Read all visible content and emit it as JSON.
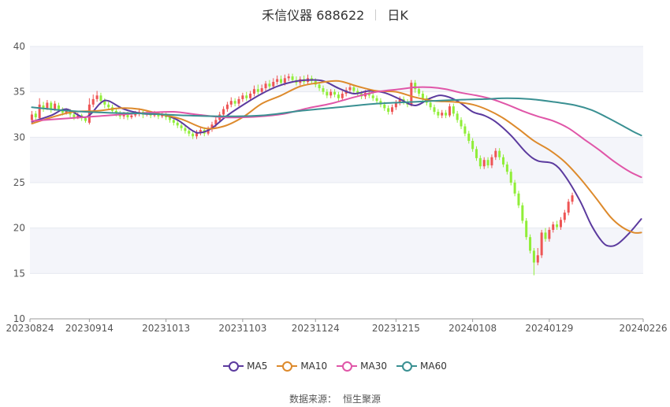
{
  "header": {
    "stock": "禾信仪器 688622",
    "period": "日K"
  },
  "source": {
    "label": "数据来源：",
    "provider": "恒生聚源"
  },
  "colors": {
    "up": "#ee5555",
    "down": "#90ee38",
    "grid": "#e6e9f0",
    "band": "#f4f5fa"
  },
  "chart_data": {
    "type": "line",
    "title": "禾信仪器 688622 日K",
    "y_ticks": [
      10,
      15,
      20,
      25,
      30,
      35,
      40
    ],
    "ylim": [
      10,
      40
    ],
    "x_ticks": [
      "20230824",
      "20230914",
      "20231013",
      "20231103",
      "20231124",
      "20231215",
      "20240108",
      "20240129",
      "20240226"
    ],
    "x_tick_index": [
      0,
      15,
      35,
      55,
      74,
      95,
      115,
      135,
      159
    ],
    "n_days": 160,
    "candles_note": "daily candlesticks, index 0..159, values [open, close, low, high]",
    "candles": [
      [
        31.9,
        32.5,
        31.6,
        32.9
      ],
      [
        32.6,
        32.2,
        31.8,
        32.9
      ],
      [
        32.1,
        33.6,
        31.9,
        34.3
      ],
      [
        33.5,
        33.2,
        32.8,
        33.9
      ],
      [
        33.2,
        33.8,
        33.0,
        34.1
      ],
      [
        33.8,
        33.1,
        32.7,
        34.0
      ],
      [
        33.1,
        33.7,
        32.9,
        34.0
      ],
      [
        33.5,
        33.1,
        32.8,
        33.8
      ],
      [
        33.1,
        32.7,
        32.4,
        33.3
      ],
      [
        32.7,
        32.9,
        32.5,
        33.2
      ],
      [
        32.9,
        32.5,
        32.2,
        33.1
      ],
      [
        32.5,
        32.2,
        31.9,
        32.7
      ],
      [
        32.2,
        32.4,
        32.0,
        32.7
      ],
      [
        32.4,
        32.1,
        31.8,
        32.6
      ],
      [
        32.1,
        31.8,
        31.6,
        32.3
      ],
      [
        31.6,
        33.6,
        31.4,
        34.3
      ],
      [
        33.6,
        34.2,
        33.3,
        34.7
      ],
      [
        34.2,
        34.6,
        33.9,
        35.1
      ],
      [
        34.6,
        34.0,
        33.6,
        34.9
      ],
      [
        34.0,
        33.6,
        33.2,
        34.3
      ],
      [
        33.6,
        33.3,
        33.0,
        33.9
      ],
      [
        33.3,
        32.9,
        32.6,
        33.6
      ],
      [
        32.9,
        32.6,
        32.3,
        33.2
      ],
      [
        32.6,
        32.3,
        32.0,
        32.9
      ],
      [
        32.3,
        32.5,
        32.0,
        32.8
      ],
      [
        32.5,
        32.2,
        31.9,
        32.8
      ],
      [
        32.2,
        32.4,
        32.0,
        32.7
      ],
      [
        32.4,
        32.6,
        32.2,
        32.9
      ],
      [
        32.6,
        32.8,
        32.3,
        33.2
      ],
      [
        32.8,
        32.5,
        32.1,
        33.1
      ],
      [
        32.5,
        32.7,
        32.3,
        33.0
      ],
      [
        32.7,
        32.4,
        32.1,
        32.9
      ],
      [
        32.4,
        32.6,
        32.2,
        32.9
      ],
      [
        32.6,
        32.3,
        32.0,
        32.8
      ],
      [
        32.3,
        32.5,
        32.1,
        32.8
      ],
      [
        32.5,
        32.2,
        31.9,
        32.7
      ],
      [
        32.2,
        31.9,
        31.6,
        32.5
      ],
      [
        31.9,
        31.6,
        31.3,
        32.2
      ],
      [
        31.6,
        31.3,
        31.0,
        31.9
      ],
      [
        31.3,
        31.0,
        30.7,
        31.6
      ],
      [
        31.0,
        30.7,
        30.4,
        31.3
      ],
      [
        30.7,
        30.4,
        30.1,
        31.0
      ],
      [
        30.4,
        30.1,
        29.8,
        30.7
      ],
      [
        30.1,
        30.5,
        29.8,
        30.8
      ],
      [
        30.5,
        30.8,
        30.2,
        31.1
      ],
      [
        30.8,
        30.4,
        30.1,
        31.1
      ],
      [
        30.4,
        30.9,
        30.2,
        31.2
      ],
      [
        30.9,
        31.4,
        30.6,
        31.7
      ],
      [
        31.4,
        31.9,
        31.1,
        32.2
      ],
      [
        31.9,
        32.5,
        31.6,
        32.8
      ],
      [
        32.5,
        33.1,
        32.2,
        33.4
      ],
      [
        33.1,
        33.6,
        32.8,
        33.9
      ],
      [
        33.6,
        34.0,
        33.3,
        34.4
      ],
      [
        34.0,
        33.7,
        33.4,
        34.3
      ],
      [
        33.7,
        34.2,
        33.4,
        34.5
      ],
      [
        34.2,
        34.6,
        33.9,
        34.9
      ],
      [
        34.6,
        34.3,
        34.0,
        35.0
      ],
      [
        34.3,
        34.8,
        34.0,
        35.1
      ],
      [
        34.8,
        35.3,
        34.5,
        35.7
      ],
      [
        35.3,
        35.0,
        34.7,
        35.8
      ],
      [
        35.0,
        35.4,
        34.7,
        35.8
      ],
      [
        35.4,
        35.9,
        35.1,
        36.2
      ],
      [
        35.9,
        35.6,
        35.3,
        36.3
      ],
      [
        35.6,
        36.1,
        35.3,
        36.5
      ],
      [
        36.1,
        36.4,
        35.8,
        36.8
      ],
      [
        36.4,
        36.0,
        35.7,
        36.8
      ],
      [
        36.0,
        36.5,
        35.7,
        36.9
      ],
      [
        36.5,
        36.7,
        36.2,
        37.0
      ],
      [
        36.7,
        36.3,
        36.0,
        37.0
      ],
      [
        36.3,
        36.0,
        35.7,
        36.7
      ],
      [
        36.0,
        36.4,
        35.7,
        36.7
      ],
      [
        36.4,
        36.1,
        35.8,
        36.8
      ],
      [
        36.1,
        36.5,
        35.8,
        36.9
      ],
      [
        36.5,
        36.2,
        35.9,
        36.8
      ],
      [
        36.2,
        35.8,
        35.5,
        36.5
      ],
      [
        35.8,
        35.4,
        35.1,
        36.1
      ],
      [
        35.4,
        35.0,
        34.7,
        35.7
      ],
      [
        35.0,
        34.6,
        34.3,
        35.3
      ],
      [
        34.6,
        35.0,
        34.3,
        35.3
      ],
      [
        35.0,
        34.7,
        34.4,
        35.3
      ],
      [
        34.7,
        34.3,
        34.0,
        35.0
      ],
      [
        34.3,
        34.8,
        34.0,
        35.1
      ],
      [
        34.8,
        35.2,
        34.5,
        35.5
      ],
      [
        35.2,
        35.5,
        34.9,
        35.8
      ],
      [
        35.5,
        35.1,
        34.8,
        35.8
      ],
      [
        35.1,
        34.8,
        34.5,
        35.4
      ],
      [
        34.8,
        34.5,
        34.2,
        35.1
      ],
      [
        34.5,
        34.9,
        34.2,
        35.2
      ],
      [
        34.9,
        34.6,
        34.3,
        35.2
      ],
      [
        34.6,
        34.3,
        34.0,
        34.9
      ],
      [
        34.3,
        34.0,
        33.7,
        34.6
      ],
      [
        34.0,
        33.6,
        33.3,
        34.3
      ],
      [
        33.6,
        33.2,
        32.9,
        33.9
      ],
      [
        33.2,
        32.8,
        32.5,
        33.5
      ],
      [
        32.8,
        33.3,
        32.5,
        33.6
      ],
      [
        33.3,
        33.8,
        33.0,
        34.1
      ],
      [
        33.8,
        34.2,
        33.5,
        34.5
      ],
      [
        34.2,
        33.9,
        33.6,
        34.5
      ],
      [
        33.9,
        33.6,
        33.3,
        34.2
      ],
      [
        33.6,
        36.0,
        33.4,
        36.3
      ],
      [
        36.0,
        35.3,
        34.9,
        36.3
      ],
      [
        35.3,
        34.8,
        34.5,
        35.6
      ],
      [
        34.8,
        34.3,
        34.0,
        35.1
      ],
      [
        34.3,
        33.8,
        33.5,
        34.6
      ],
      [
        33.8,
        33.3,
        33.0,
        34.1
      ],
      [
        33.3,
        32.8,
        32.5,
        33.6
      ],
      [
        32.8,
        32.4,
        32.1,
        33.1
      ],
      [
        32.4,
        32.7,
        32.1,
        33.0
      ],
      [
        32.7,
        32.4,
        32.1,
        33.0
      ],
      [
        32.4,
        33.4,
        32.2,
        33.7
      ],
      [
        33.4,
        32.6,
        32.3,
        33.7
      ],
      [
        32.6,
        31.9,
        31.6,
        32.9
      ],
      [
        31.9,
        31.2,
        30.9,
        32.2
      ],
      [
        31.2,
        30.4,
        30.1,
        31.5
      ],
      [
        30.4,
        29.6,
        29.3,
        30.7
      ],
      [
        29.6,
        28.7,
        28.4,
        29.9
      ],
      [
        28.7,
        27.7,
        27.4,
        29.0
      ],
      [
        27.7,
        26.8,
        26.5,
        28.0
      ],
      [
        26.8,
        27.5,
        26.5,
        27.8
      ],
      [
        27.5,
        26.9,
        26.6,
        27.8
      ],
      [
        26.9,
        27.8,
        26.6,
        28.1
      ],
      [
        27.8,
        28.5,
        27.5,
        28.8
      ],
      [
        28.5,
        27.8,
        27.5,
        28.8
      ],
      [
        27.8,
        27.0,
        26.7,
        28.1
      ],
      [
        27.0,
        26.2,
        25.9,
        27.3
      ],
      [
        26.2,
        25.0,
        24.7,
        26.5
      ],
      [
        25.0,
        23.8,
        23.5,
        25.3
      ],
      [
        23.8,
        22.5,
        22.2,
        24.1
      ],
      [
        22.5,
        20.8,
        20.5,
        22.8
      ],
      [
        20.8,
        19.0,
        18.7,
        21.1
      ],
      [
        19.0,
        17.5,
        17.2,
        19.3
      ],
      [
        17.5,
        16.2,
        14.8,
        17.8
      ],
      [
        16.2,
        17.0,
        15.9,
        17.8
      ],
      [
        17.0,
        19.5,
        16.7,
        19.8
      ],
      [
        19.5,
        18.8,
        18.5,
        20.0
      ],
      [
        18.8,
        19.8,
        18.5,
        20.1
      ],
      [
        19.8,
        20.4,
        19.5,
        20.7
      ],
      [
        20.4,
        20.1,
        19.8,
        20.8
      ],
      [
        20.1,
        20.9,
        19.8,
        21.2
      ],
      [
        20.9,
        21.7,
        20.6,
        22.0
      ],
      [
        21.7,
        22.9,
        21.4,
        23.2
      ],
      [
        22.9,
        23.6,
        22.6,
        23.9
      ]
    ],
    "series": [
      {
        "name": "MA5",
        "color": "#5b3a9e",
        "values": [
          [
            0,
            31.7
          ],
          [
            5,
            32.4
          ],
          [
            9,
            33.1
          ],
          [
            14,
            32.2
          ],
          [
            18,
            33.8
          ],
          [
            20,
            34.0
          ],
          [
            24,
            33.1
          ],
          [
            29,
            32.6
          ],
          [
            34,
            32.5
          ],
          [
            38,
            31.9
          ],
          [
            42,
            30.7
          ],
          [
            44,
            30.5
          ],
          [
            47,
            31.0
          ],
          [
            51,
            32.4
          ],
          [
            56,
            33.8
          ],
          [
            60,
            34.8
          ],
          [
            64,
            35.6
          ],
          [
            68,
            36.1
          ],
          [
            72,
            36.3
          ],
          [
            76,
            36.2
          ],
          [
            80,
            35.4
          ],
          [
            84,
            34.8
          ],
          [
            88,
            35.1
          ],
          [
            92,
            34.9
          ],
          [
            96,
            34.2
          ],
          [
            100,
            33.5
          ],
          [
            104,
            34.3
          ],
          [
            107,
            34.6
          ],
          [
            111,
            34.0
          ],
          [
            115,
            32.8
          ],
          [
            118,
            32.4
          ],
          [
            121,
            31.7
          ],
          [
            125,
            30.2
          ],
          [
            129,
            28.3
          ],
          [
            132,
            27.4
          ],
          [
            136,
            27.1
          ],
          [
            139,
            25.8
          ],
          [
            143,
            23.0
          ],
          [
            146,
            20.3
          ],
          [
            149,
            18.4
          ],
          [
            151,
            18.0
          ],
          [
            153,
            18.3
          ],
          [
            156,
            19.5
          ],
          [
            159,
            21.0
          ]
        ]
      },
      {
        "name": "MA10",
        "color": "#dd8a2c",
        "values": [
          [
            0,
            31.5
          ],
          [
            6,
            32.3
          ],
          [
            11,
            32.8
          ],
          [
            17,
            32.9
          ],
          [
            23,
            33.2
          ],
          [
            28,
            33.1
          ],
          [
            33,
            32.6
          ],
          [
            39,
            32.0
          ],
          [
            45,
            31.0
          ],
          [
            50,
            31.2
          ],
          [
            55,
            32.2
          ],
          [
            60,
            33.7
          ],
          [
            65,
            34.6
          ],
          [
            70,
            35.6
          ],
          [
            75,
            36.0
          ],
          [
            80,
            36.2
          ],
          [
            85,
            35.6
          ],
          [
            90,
            35.1
          ],
          [
            95,
            35.0
          ],
          [
            100,
            34.4
          ],
          [
            105,
            34.0
          ],
          [
            110,
            33.9
          ],
          [
            115,
            33.6
          ],
          [
            119,
            33.0
          ],
          [
            123,
            32.1
          ],
          [
            127,
            30.9
          ],
          [
            131,
            29.6
          ],
          [
            135,
            28.6
          ],
          [
            139,
            27.3
          ],
          [
            143,
            25.5
          ],
          [
            147,
            23.4
          ],
          [
            151,
            21.2
          ],
          [
            154,
            20.1
          ],
          [
            157,
            19.5
          ],
          [
            159,
            19.5
          ]
        ]
      },
      {
        "name": "MA30",
        "color": "#e056a8",
        "values": [
          [
            0,
            31.8
          ],
          [
            10,
            32.1
          ],
          [
            20,
            32.4
          ],
          [
            30,
            32.7
          ],
          [
            37,
            32.8
          ],
          [
            43,
            32.5
          ],
          [
            50,
            32.2
          ],
          [
            55,
            32.2
          ],
          [
            60,
            32.3
          ],
          [
            66,
            32.6
          ],
          [
            72,
            33.2
          ],
          [
            78,
            33.7
          ],
          [
            84,
            34.4
          ],
          [
            90,
            35.0
          ],
          [
            96,
            35.3
          ],
          [
            100,
            35.5
          ],
          [
            104,
            35.5
          ],
          [
            108,
            35.3
          ],
          [
            112,
            34.9
          ],
          [
            116,
            34.6
          ],
          [
            120,
            34.2
          ],
          [
            124,
            33.6
          ],
          [
            128,
            32.9
          ],
          [
            132,
            32.3
          ],
          [
            136,
            31.8
          ],
          [
            140,
            31.0
          ],
          [
            144,
            29.8
          ],
          [
            148,
            28.6
          ],
          [
            152,
            27.3
          ],
          [
            156,
            26.2
          ],
          [
            159,
            25.6
          ]
        ]
      },
      {
        "name": "MA60",
        "color": "#3a9092",
        "values": [
          [
            0,
            33.3
          ],
          [
            10,
            32.9
          ],
          [
            20,
            32.7
          ],
          [
            30,
            32.6
          ],
          [
            40,
            32.4
          ],
          [
            50,
            32.3
          ],
          [
            60,
            32.4
          ],
          [
            70,
            32.9
          ],
          [
            80,
            33.3
          ],
          [
            90,
            33.7
          ],
          [
            100,
            33.9
          ],
          [
            110,
            34.1
          ],
          [
            118,
            34.2
          ],
          [
            124,
            34.3
          ],
          [
            130,
            34.2
          ],
          [
            136,
            33.9
          ],
          [
            142,
            33.5
          ],
          [
            146,
            33.0
          ],
          [
            150,
            32.2
          ],
          [
            154,
            31.3
          ],
          [
            157,
            30.6
          ],
          [
            159,
            30.2
          ]
        ]
      }
    ]
  }
}
